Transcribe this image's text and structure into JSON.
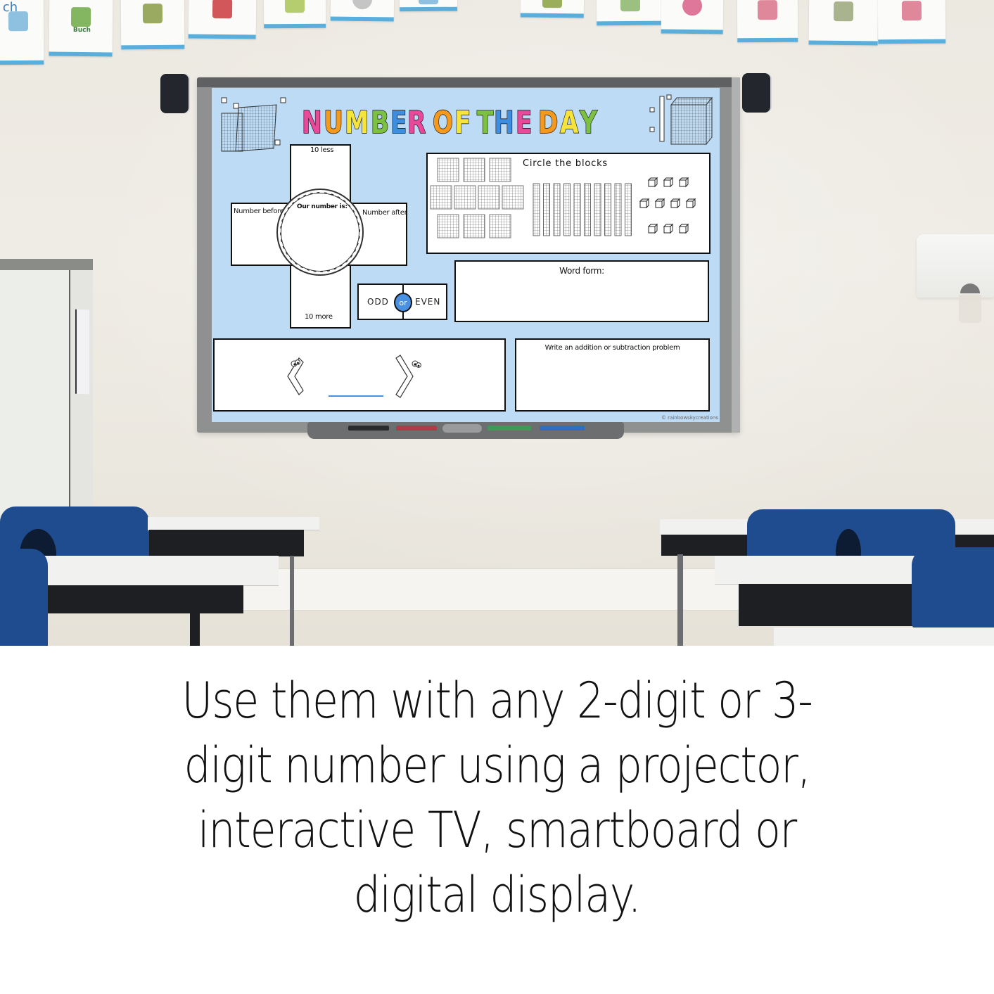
{
  "image": {
    "kind": "classroom product mockup",
    "scene": "whiteboard in classroom with desks and blue chairs"
  },
  "wall_cards": [
    {
      "label": "ch",
      "icon": "boy-icon"
    },
    {
      "label": "Buch",
      "icon": "book-icon"
    },
    {
      "label": "",
      "icon": "nest-icon"
    },
    {
      "label": "",
      "icon": "teapot-icon"
    },
    {
      "label": "",
      "icon": "box-icon"
    },
    {
      "label": "",
      "icon": "clock-icon"
    },
    {
      "label": "",
      "icon": "card-icon"
    },
    {
      "label": "",
      "icon": "frog-icon"
    },
    {
      "label": "",
      "icon": "house-icon"
    },
    {
      "label": "",
      "icon": "ball-icon"
    },
    {
      "label": "",
      "icon": "pliers-icon"
    },
    {
      "label": "",
      "icon": "fork-icon"
    },
    {
      "label": "",
      "icon": "scissors-icon"
    }
  ],
  "board": {
    "title_letters": [
      {
        "ch": "N",
        "color": "#e8499a"
      },
      {
        "ch": "U",
        "color": "#f39a1e"
      },
      {
        "ch": "M",
        "color": "#f6e43a"
      },
      {
        "ch": "B",
        "color": "#7dc142"
      },
      {
        "ch": "E",
        "color": "#3d8ee0"
      },
      {
        "ch": "R",
        "color": "#e8499a"
      },
      {
        "ch": " ",
        "color": ""
      },
      {
        "ch": "O",
        "color": "#f39a1e"
      },
      {
        "ch": "F",
        "color": "#f6e43a"
      },
      {
        "ch": " ",
        "color": ""
      },
      {
        "ch": "T",
        "color": "#7dc142"
      },
      {
        "ch": "H",
        "color": "#3d8ee0"
      },
      {
        "ch": "E",
        "color": "#e8499a"
      },
      {
        "ch": " ",
        "color": ""
      },
      {
        "ch": "D",
        "color": "#f39a1e"
      },
      {
        "ch": "A",
        "color": "#f6e43a"
      },
      {
        "ch": "Y",
        "color": "#7dc142"
      }
    ],
    "title": "NUMBER OF THE DAY",
    "background_color": "#bddbf5",
    "accent_color": "#4a90e2",
    "cross": {
      "ten_less": "10 less",
      "number_before": "Number before",
      "our_number": "Our number is:",
      "number_after": "Number after",
      "ten_more": "10 more"
    },
    "odd_even": {
      "odd": "ODD",
      "or": "or",
      "even": "EVEN"
    },
    "circle_blocks": {
      "label": "Circle the blocks",
      "hundreds_count": 10,
      "tens_count": 10,
      "ones_count": 10
    },
    "word_form": "Word form:",
    "compare": {
      "left_symbol": "<",
      "right_symbol": ">"
    },
    "problem": "Write an addition or subtraction problem",
    "copyright": "© rainbowskycreations"
  },
  "caption": {
    "lines": [
      "Use them with any 2-digit or 3-",
      "digit number using a projector,",
      "interactive TV, smartboard or",
      "digital display."
    ],
    "full_text": "Use them with any 2-digit or 3-digit number using a projector, interactive TV, smartboard or digital display."
  }
}
